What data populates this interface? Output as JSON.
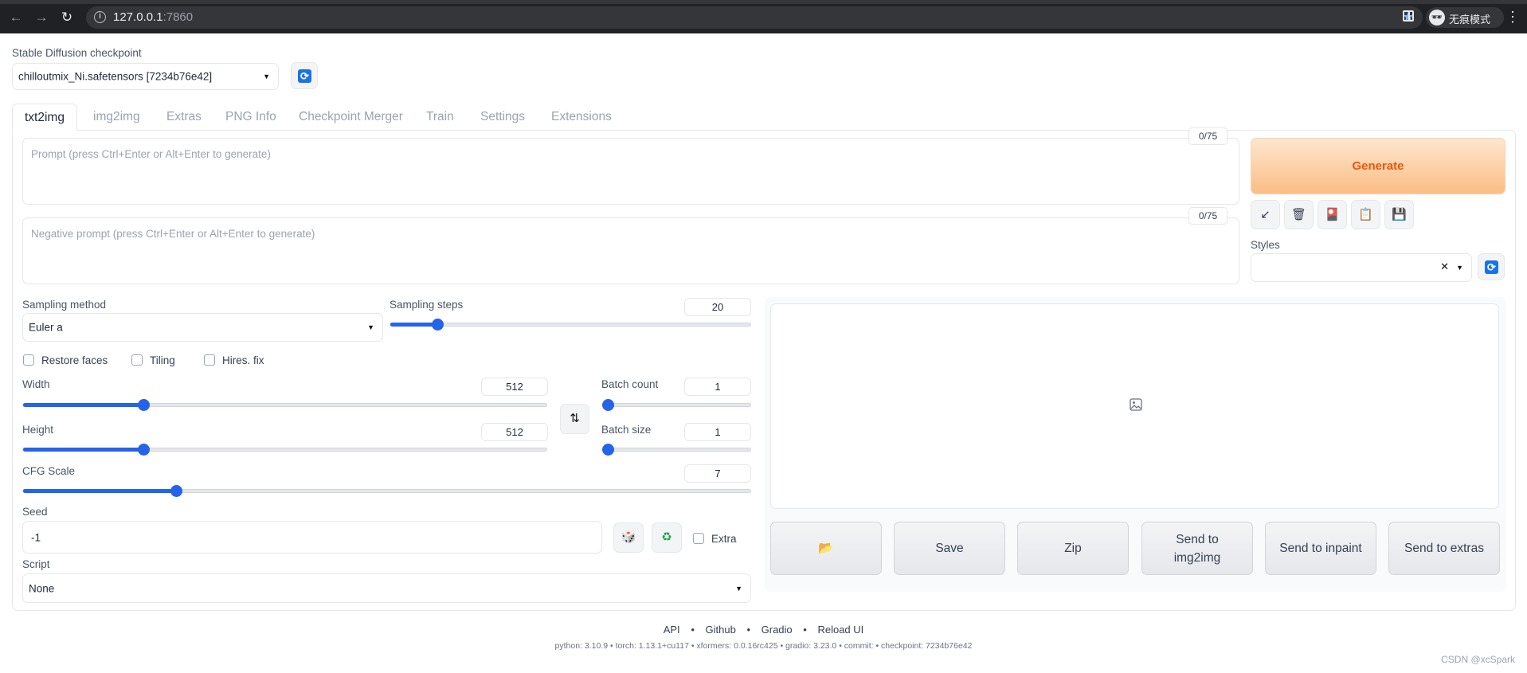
{
  "browser": {
    "url_host": "127.0.0.1",
    "url_port": ":7860",
    "incognito_label": "无痕模式"
  },
  "checkpoint": {
    "label": "Stable Diffusion checkpoint",
    "value": "chilloutmix_Ni.safetensors [7234b76e42]"
  },
  "tabs": [
    "txt2img",
    "img2img",
    "Extras",
    "PNG Info",
    "Checkpoint Merger",
    "Train",
    "Settings",
    "Extensions"
  ],
  "prompt": {
    "placeholder": "Prompt (press Ctrl+Enter or Alt+Enter to generate)",
    "counter": "0/75"
  },
  "negative_prompt": {
    "placeholder": "Negative prompt (press Ctrl+Enter or Alt+Enter to generate)",
    "counter": "0/75"
  },
  "generate_label": "Generate",
  "tool_icons": [
    "arrow-icon",
    "trash-icon",
    "red-card-icon",
    "clipboard-icon",
    "save-icon"
  ],
  "styles_label": "Styles",
  "sampling": {
    "method_label": "Sampling method",
    "method_value": "Euler a",
    "steps_label": "Sampling steps",
    "steps_value": "20",
    "steps_fraction": 0.13
  },
  "checkboxes": {
    "restore_faces": "Restore faces",
    "tiling": "Tiling",
    "hires_fix": "Hires. fix"
  },
  "width": {
    "label": "Width",
    "value": "512",
    "fraction": 0.23
  },
  "height": {
    "label": "Height",
    "value": "512",
    "fraction": 0.23
  },
  "batch_count": {
    "label": "Batch count",
    "value": "1",
    "fraction": 0.0
  },
  "batch_size": {
    "label": "Batch size",
    "value": "1",
    "fraction": 0.0
  },
  "cfg": {
    "label": "CFG Scale",
    "value": "7",
    "fraction": 0.21
  },
  "seed": {
    "label": "Seed",
    "value": "-1",
    "extra_label": "Extra"
  },
  "script": {
    "label": "Script",
    "value": "None"
  },
  "actions": {
    "folder_icon": "📂",
    "save": "Save",
    "zip": "Zip",
    "send_img2img_1": "Send to",
    "send_img2img_2": "img2img",
    "send_inpaint": "Send to inpaint",
    "send_extras": "Send to extras"
  },
  "footer": {
    "api": "API",
    "github": "Github",
    "gradio": "Gradio",
    "reload": "Reload UI",
    "meta": "python: 3.10.9  •  torch: 1.13.1+cu117  •  xformers: 0.0.16rc425  •  gradio: 3.23.0  •  commit:  •  checkpoint: 7234b76e42"
  },
  "watermark": "CSDN @xcSpark"
}
